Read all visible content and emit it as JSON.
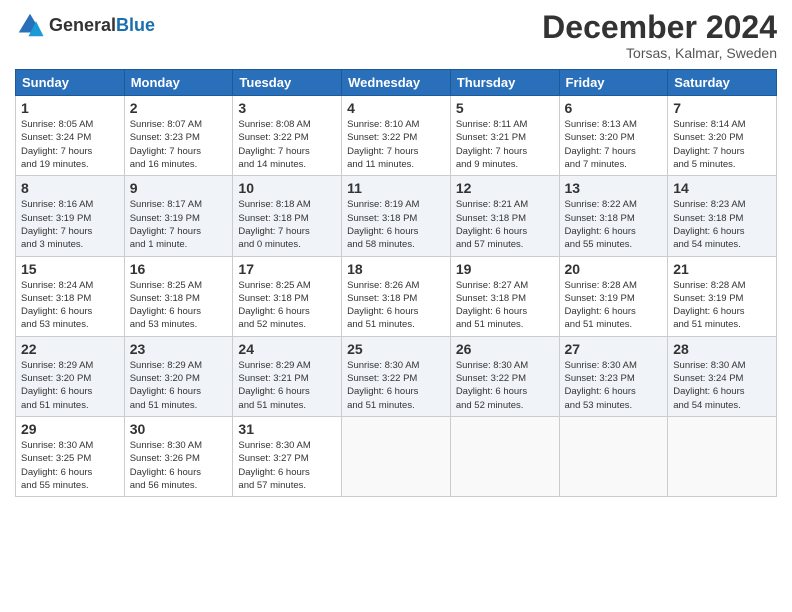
{
  "logo": {
    "general": "General",
    "blue": "Blue"
  },
  "header": {
    "title": "December 2024",
    "subtitle": "Torsas, Kalmar, Sweden"
  },
  "days_of_week": [
    "Sunday",
    "Monday",
    "Tuesday",
    "Wednesday",
    "Thursday",
    "Friday",
    "Saturday"
  ],
  "weeks": [
    [
      {
        "day": "1",
        "info": "Sunrise: 8:05 AM\nSunset: 3:24 PM\nDaylight: 7 hours\nand 19 minutes."
      },
      {
        "day": "2",
        "info": "Sunrise: 8:07 AM\nSunset: 3:23 PM\nDaylight: 7 hours\nand 16 minutes."
      },
      {
        "day": "3",
        "info": "Sunrise: 8:08 AM\nSunset: 3:22 PM\nDaylight: 7 hours\nand 14 minutes."
      },
      {
        "day": "4",
        "info": "Sunrise: 8:10 AM\nSunset: 3:22 PM\nDaylight: 7 hours\nand 11 minutes."
      },
      {
        "day": "5",
        "info": "Sunrise: 8:11 AM\nSunset: 3:21 PM\nDaylight: 7 hours\nand 9 minutes."
      },
      {
        "day": "6",
        "info": "Sunrise: 8:13 AM\nSunset: 3:20 PM\nDaylight: 7 hours\nand 7 minutes."
      },
      {
        "day": "7",
        "info": "Sunrise: 8:14 AM\nSunset: 3:20 PM\nDaylight: 7 hours\nand 5 minutes."
      }
    ],
    [
      {
        "day": "8",
        "info": "Sunrise: 8:16 AM\nSunset: 3:19 PM\nDaylight: 7 hours\nand 3 minutes."
      },
      {
        "day": "9",
        "info": "Sunrise: 8:17 AM\nSunset: 3:19 PM\nDaylight: 7 hours\nand 1 minute."
      },
      {
        "day": "10",
        "info": "Sunrise: 8:18 AM\nSunset: 3:18 PM\nDaylight: 7 hours\nand 0 minutes."
      },
      {
        "day": "11",
        "info": "Sunrise: 8:19 AM\nSunset: 3:18 PM\nDaylight: 6 hours\nand 58 minutes."
      },
      {
        "day": "12",
        "info": "Sunrise: 8:21 AM\nSunset: 3:18 PM\nDaylight: 6 hours\nand 57 minutes."
      },
      {
        "day": "13",
        "info": "Sunrise: 8:22 AM\nSunset: 3:18 PM\nDaylight: 6 hours\nand 55 minutes."
      },
      {
        "day": "14",
        "info": "Sunrise: 8:23 AM\nSunset: 3:18 PM\nDaylight: 6 hours\nand 54 minutes."
      }
    ],
    [
      {
        "day": "15",
        "info": "Sunrise: 8:24 AM\nSunset: 3:18 PM\nDaylight: 6 hours\nand 53 minutes."
      },
      {
        "day": "16",
        "info": "Sunrise: 8:25 AM\nSunset: 3:18 PM\nDaylight: 6 hours\nand 53 minutes."
      },
      {
        "day": "17",
        "info": "Sunrise: 8:25 AM\nSunset: 3:18 PM\nDaylight: 6 hours\nand 52 minutes."
      },
      {
        "day": "18",
        "info": "Sunrise: 8:26 AM\nSunset: 3:18 PM\nDaylight: 6 hours\nand 51 minutes."
      },
      {
        "day": "19",
        "info": "Sunrise: 8:27 AM\nSunset: 3:18 PM\nDaylight: 6 hours\nand 51 minutes."
      },
      {
        "day": "20",
        "info": "Sunrise: 8:28 AM\nSunset: 3:19 PM\nDaylight: 6 hours\nand 51 minutes."
      },
      {
        "day": "21",
        "info": "Sunrise: 8:28 AM\nSunset: 3:19 PM\nDaylight: 6 hours\nand 51 minutes."
      }
    ],
    [
      {
        "day": "22",
        "info": "Sunrise: 8:29 AM\nSunset: 3:20 PM\nDaylight: 6 hours\nand 51 minutes."
      },
      {
        "day": "23",
        "info": "Sunrise: 8:29 AM\nSunset: 3:20 PM\nDaylight: 6 hours\nand 51 minutes."
      },
      {
        "day": "24",
        "info": "Sunrise: 8:29 AM\nSunset: 3:21 PM\nDaylight: 6 hours\nand 51 minutes."
      },
      {
        "day": "25",
        "info": "Sunrise: 8:30 AM\nSunset: 3:22 PM\nDaylight: 6 hours\nand 51 minutes."
      },
      {
        "day": "26",
        "info": "Sunrise: 8:30 AM\nSunset: 3:22 PM\nDaylight: 6 hours\nand 52 minutes."
      },
      {
        "day": "27",
        "info": "Sunrise: 8:30 AM\nSunset: 3:23 PM\nDaylight: 6 hours\nand 53 minutes."
      },
      {
        "day": "28",
        "info": "Sunrise: 8:30 AM\nSunset: 3:24 PM\nDaylight: 6 hours\nand 54 minutes."
      }
    ],
    [
      {
        "day": "29",
        "info": "Sunrise: 8:30 AM\nSunset: 3:25 PM\nDaylight: 6 hours\nand 55 minutes."
      },
      {
        "day": "30",
        "info": "Sunrise: 8:30 AM\nSunset: 3:26 PM\nDaylight: 6 hours\nand 56 minutes."
      },
      {
        "day": "31",
        "info": "Sunrise: 8:30 AM\nSunset: 3:27 PM\nDaylight: 6 hours\nand 57 minutes."
      },
      {
        "day": "",
        "info": ""
      },
      {
        "day": "",
        "info": ""
      },
      {
        "day": "",
        "info": ""
      },
      {
        "day": "",
        "info": ""
      }
    ]
  ]
}
